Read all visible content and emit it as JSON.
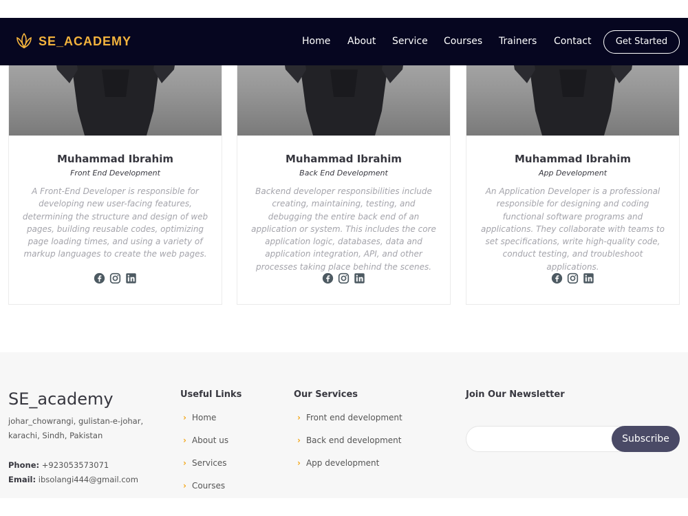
{
  "header": {
    "logo_text": "SE_ACADEMY",
    "nav": [
      {
        "label": "Home"
      },
      {
        "label": "About"
      },
      {
        "label": "Service"
      },
      {
        "label": "Courses"
      },
      {
        "label": "Trainers"
      },
      {
        "label": "Contact"
      }
    ],
    "cta_label": "Get Started"
  },
  "trainers": [
    {
      "name": "Muhammad Ibrahim",
      "role": "Front End Development",
      "description": "A Front-End Developer is responsible for developing new user-facing features, determining the structure and design of web pages, building reusable codes, optimizing page loading times, and using a variety of markup languages to create the web pages.",
      "social_icons": [
        "facebook-icon",
        "instagram-icon",
        "linkedin-icon"
      ]
    },
    {
      "name": "Muhammad Ibrahim",
      "role": "Back End Development",
      "description": "Backend developer responsibilities include creating, maintaining, testing, and debugging the entire back end of an application or system. This includes the core application logic, databases, data and application integration, API, and other processes taking place behind the scenes.",
      "social_icons": [
        "facebook-icon",
        "instagram-icon",
        "linkedin-icon"
      ]
    },
    {
      "name": "Muhammad Ibrahim",
      "role": "App Development",
      "description": "An Application Developer is a professional responsible for designing and coding functional software programs and applications. They collaborate with teams to set specifications, write high-quality code, conduct testing, and troubleshoot applications.",
      "social_icons": [
        "facebook-icon",
        "instagram-icon",
        "linkedin-icon"
      ]
    }
  ],
  "footer": {
    "brand": "SE_academy",
    "address": "johar_chowrangi, gulistan-e-johar, karachi, Sindh, Pakistan",
    "phone_label": "Phone:",
    "phone": "+923053573071",
    "email_label": "Email:",
    "email": "ibsolangi444@gmail.com",
    "useful_links": {
      "title": "Useful Links",
      "items": [
        "Home",
        "About us",
        "Services",
        "Courses"
      ]
    },
    "services": {
      "title": "Our Services",
      "items": [
        "Front end development",
        "Back end development",
        "App development"
      ]
    },
    "newsletter": {
      "title": "Join Our Newsletter",
      "input_value": "",
      "subscribe_label": "Subscribe"
    }
  },
  "colors": {
    "header_bg": "#060620",
    "accent": "#f3b33d",
    "subscribe_bg": "#4a4a66",
    "footer_bg": "#f7f7f7"
  }
}
